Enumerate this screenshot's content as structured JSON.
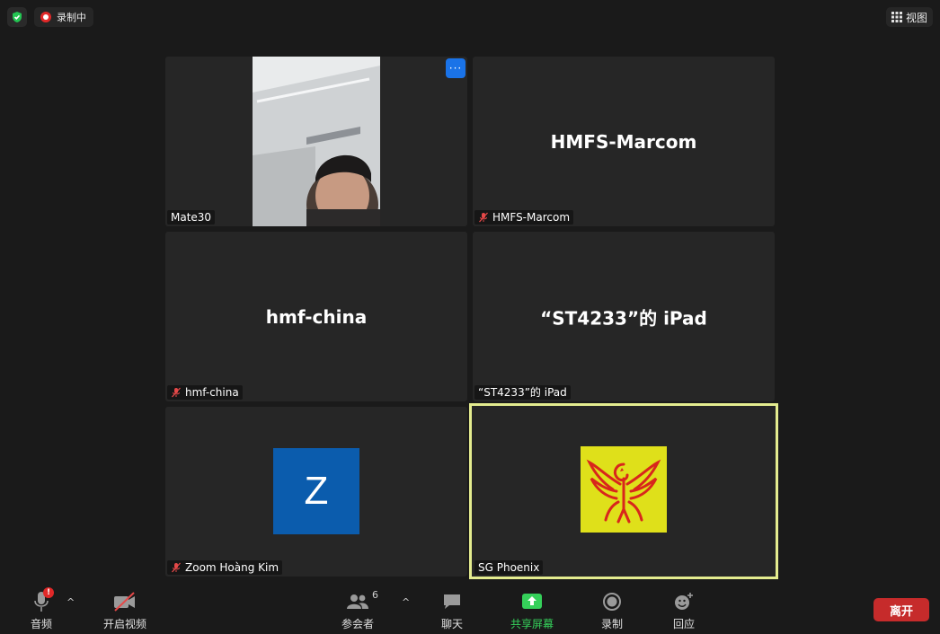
{
  "topbar": {
    "recording_label": "录制中",
    "view_label": "视图",
    "icons": [
      "shield-check-icon",
      "recording-icon",
      "grid-icon"
    ]
  },
  "participants": [
    {
      "name": "Mate30",
      "display": "",
      "mic_muted": false,
      "video_on": true
    },
    {
      "name": "HMFS-Marcom",
      "display": "HMFS-Marcom",
      "mic_muted": true,
      "video_on": false
    },
    {
      "name": "hmf-china",
      "display": "hmf-china",
      "mic_muted": true,
      "video_on": false
    },
    {
      "name": "“ST4233”的 iPad",
      "display": "“ST4233”的 iPad",
      "mic_muted": false,
      "video_on": false
    },
    {
      "name": "Zoom Hoàng Kim",
      "avatar_letter": "Z",
      "mic_muted": true,
      "video_on": false
    },
    {
      "name": "SG Phoenix",
      "mic_muted": false,
      "video_on": false,
      "active_speaker": true
    }
  ],
  "toolbar": {
    "audio_label": "音频",
    "video_label": "开启视频",
    "participants_label": "参会者",
    "participants_count": "6",
    "chat_label": "聊天",
    "share_label": "共享屏幕",
    "record_label": "录制",
    "reactions_label": "回应",
    "leave_label": "离开"
  },
  "colors": {
    "background": "#1a1a1a",
    "tile": "#262626",
    "accent_blue": "#1a73e8",
    "share_green": "#35d05a",
    "leave_red": "#c62b2b",
    "active_border": "#e4ec8f",
    "avatar_blue": "#0b5cad",
    "avatar_yellow": "#dfe01a"
  }
}
